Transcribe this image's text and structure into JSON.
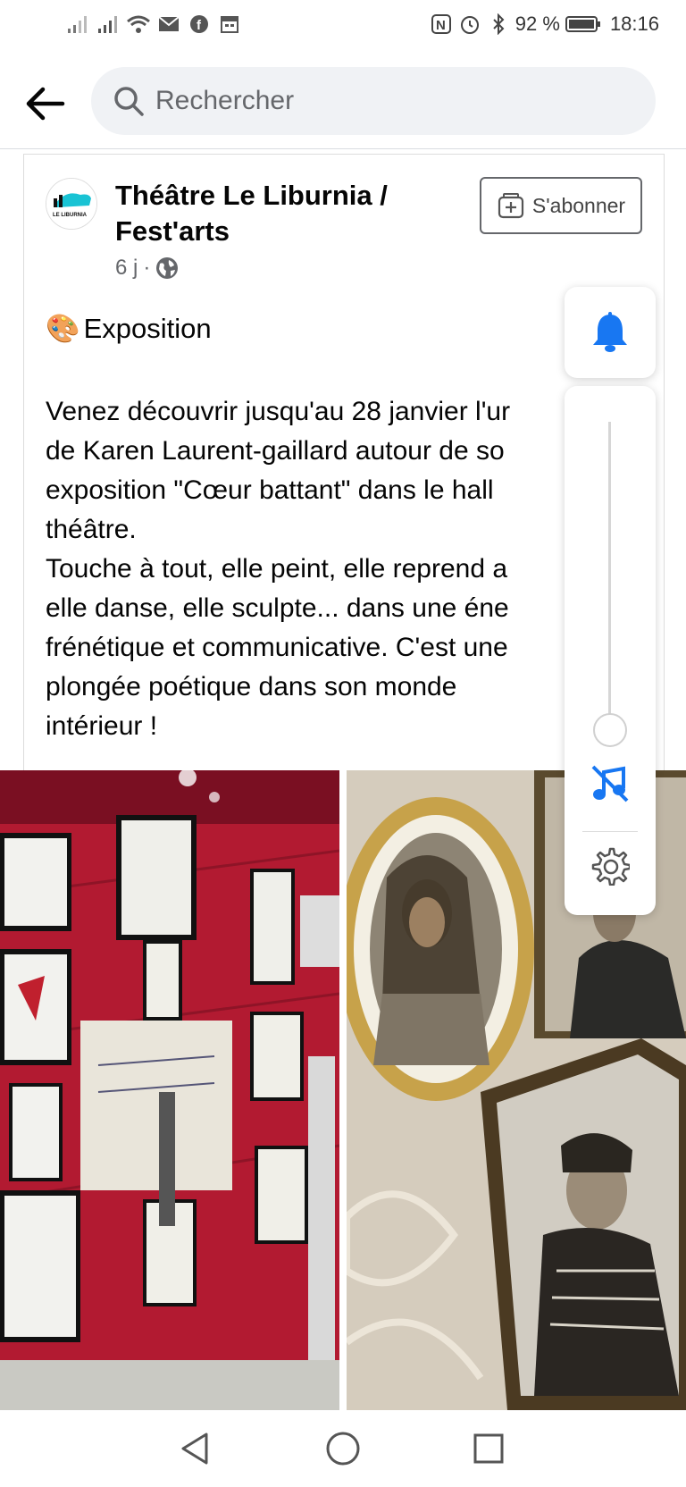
{
  "status_bar": {
    "battery": "92 %",
    "time": "18:16"
  },
  "search": {
    "placeholder": "Rechercher"
  },
  "post": {
    "page_name": "Théâtre Le Liburnia / Fest'arts",
    "time_ago": "6 j",
    "separator": "·",
    "subscribe_label": "S'abonner",
    "avatar_text": "LE LIBURNIA",
    "title_emoji": "🎨",
    "title": "Exposition",
    "body": "Venez découvrir jusqu'au 28 janvier l'ur\nde Karen Laurent-gaillard autour de so\nexposition \"Cœur battant\" dans le hall\nthéâtre.\nTouche à tout, elle peint, elle reprend a\nelle danse, elle sculpte... dans une éne\nfrénétique et communicative. C'est une\nplongée poétique dans son monde\nintérieur !"
  },
  "colors": {
    "accent": "#1877f2",
    "photo_red": "#b81f36"
  },
  "icons": [
    "back-arrow-icon",
    "search-icon",
    "globe-icon",
    "subscribe-plus-icon",
    "bell-icon",
    "music-off-icon",
    "gear-icon",
    "nav-back-icon",
    "nav-home-icon",
    "nav-recents-icon"
  ]
}
